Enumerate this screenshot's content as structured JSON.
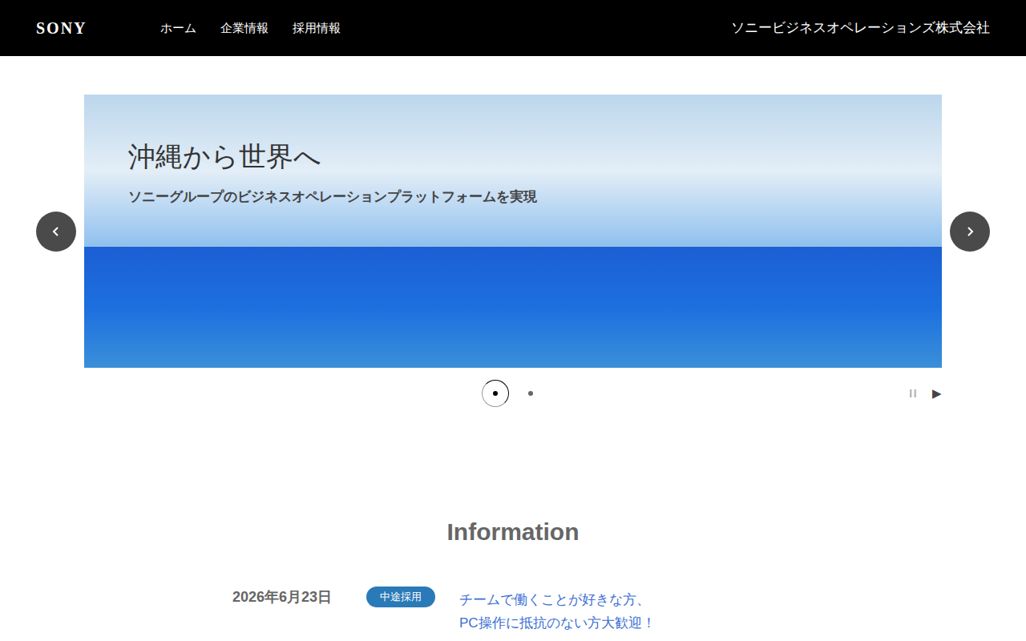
{
  "header": {
    "logo": "SONY",
    "nav": [
      {
        "label": "ホーム",
        "selected": false
      },
      {
        "label": "企業情報",
        "selected": false
      },
      {
        "label": "採用情報",
        "selected": false
      }
    ],
    "company": "ソニービジネスオペレーションズ株式会社"
  },
  "carousel": {
    "slide": {
      "title": "沖縄から世界へ",
      "subtitle": "ソニーグループのビジネスオペレーションプラットフォームを実現"
    },
    "dots": [
      {
        "selected": true
      },
      {
        "selected": false
      }
    ],
    "controls": [
      {
        "kind": "pause",
        "label": "",
        "active": false
      },
      {
        "kind": "play",
        "label": "▶",
        "active": true
      }
    ]
  },
  "information": {
    "heading": "Information",
    "items": [
      {
        "date": "2026年6月23日",
        "tag": "中途採用",
        "tag_color": "#2a7ab8",
        "lines": [
          "チームで働くことが好きな方、",
          "PC操作に抵抗のない方大歓迎！"
        ]
      }
    ]
  }
}
